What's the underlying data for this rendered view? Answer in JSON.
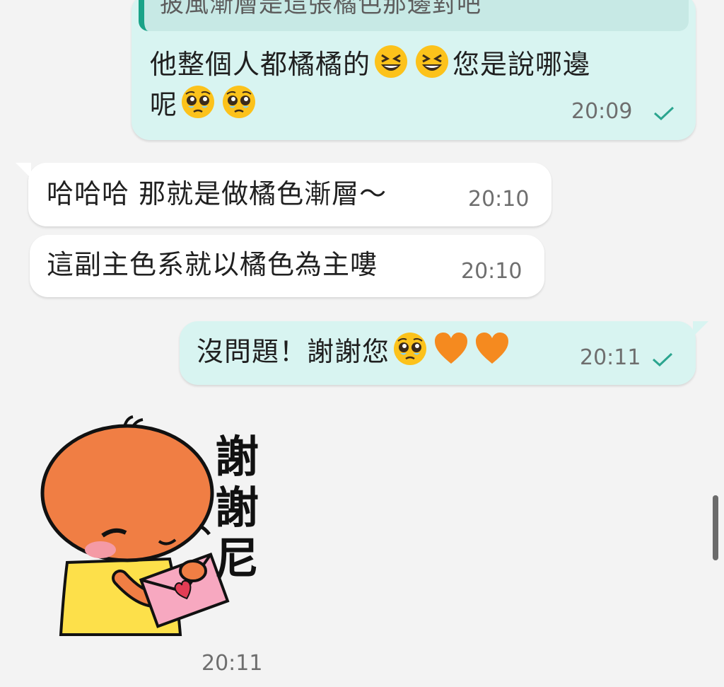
{
  "messages": [
    {
      "direction": "outgoing",
      "quote": "披風漸層是這張橘色那邊對吧",
      "text_parts": [
        "他整個人都橘橘的",
        "您是說哪邊",
        "呢"
      ],
      "emojis": [
        "grinning-squinting-face",
        "grinning-squinting-face",
        "pleading-face",
        "pleading-face"
      ],
      "time": "20:09",
      "status": "sent-check"
    },
    {
      "direction": "incoming",
      "text": "哈哈哈 那就是做橘色漸層～",
      "time": "20:10"
    },
    {
      "direction": "incoming",
      "text": "這副主色系就以橘色為主嘍",
      "time": "20:10"
    },
    {
      "direction": "outgoing",
      "text": "沒問題！謝謝您",
      "emojis": [
        "pleading-face",
        "orange-heart",
        "orange-heart"
      ],
      "time": "20:11",
      "status": "sent-check"
    },
    {
      "direction": "incoming",
      "type": "sticker",
      "sticker_caption": [
        "謝",
        "謝",
        "尼"
      ],
      "time": "20:11"
    }
  ],
  "colors": {
    "background": "#f3f3f3",
    "outgoing_bubble": "#d8f4f1",
    "incoming_bubble": "#ffffff",
    "quote_bar": "#1aa388",
    "check": "#2ba58f",
    "sticker_orange": "#f07e44",
    "sticker_yellow": "#fde04a"
  }
}
